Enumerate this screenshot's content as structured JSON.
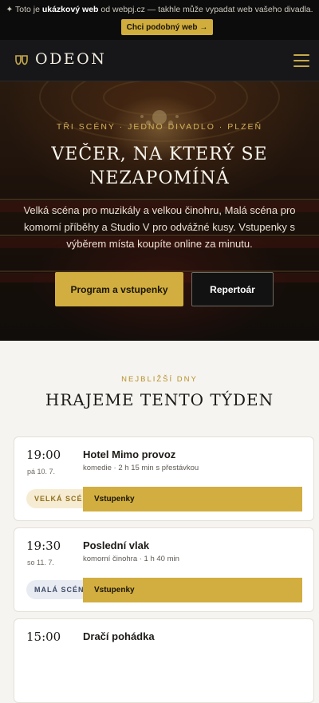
{
  "promo": {
    "text_prefix": "✦ Toto je ",
    "text_bold": "ukázkový web",
    "text_suffix": " od webpj.cz — takhle může vypadat web vašeho divadla.",
    "button_label": "Chci podobný web →"
  },
  "header": {
    "logo_text": "ODEON",
    "logo_icon": "theatre-masks-icon",
    "menu_icon": "hamburger-menu-icon"
  },
  "hero": {
    "kicker": "TŘI SCÉNY · JEDNO DIVADLO · PLZEŇ",
    "title_line1": "VEČER, NA KTERÝ SE",
    "title_line2": "NEZAPOMÍNÁ",
    "description": "Velká scéna pro muzikály a velkou činohru, Malá scéna pro komorní příběhy a Studio V pro odvážné kusy. Vstupenky s výběrem místa koupíte online za minutu.",
    "primary_button": "Program a vstupenky",
    "secondary_button": "Repertoár"
  },
  "program": {
    "kicker": "NEJBLIŽŠÍ DNY",
    "title": "HRAJEME TENTO TÝDEN",
    "events": [
      {
        "time": "19:00",
        "date": "pá 10. 7.",
        "title": "Hotel Mimo provoz",
        "meta": "komedie · 2 h 15 min s přestávkou",
        "stage": "VELKÁ SCÉNA",
        "button": "Vstupenky"
      },
      {
        "time": "19:30",
        "date": "so 11. 7.",
        "title": "Poslední vlak",
        "meta": "komorní činohra · 1 h 40 min",
        "stage": "MALÁ SCÉNA",
        "button": "Vstupenky"
      },
      {
        "time": "15:00",
        "title": "Dračí pohádka"
      }
    ]
  },
  "colors": {
    "accent_gold": "#d1ae3f",
    "dark_bg": "#17171a",
    "page_bg": "#f6f4f0"
  }
}
